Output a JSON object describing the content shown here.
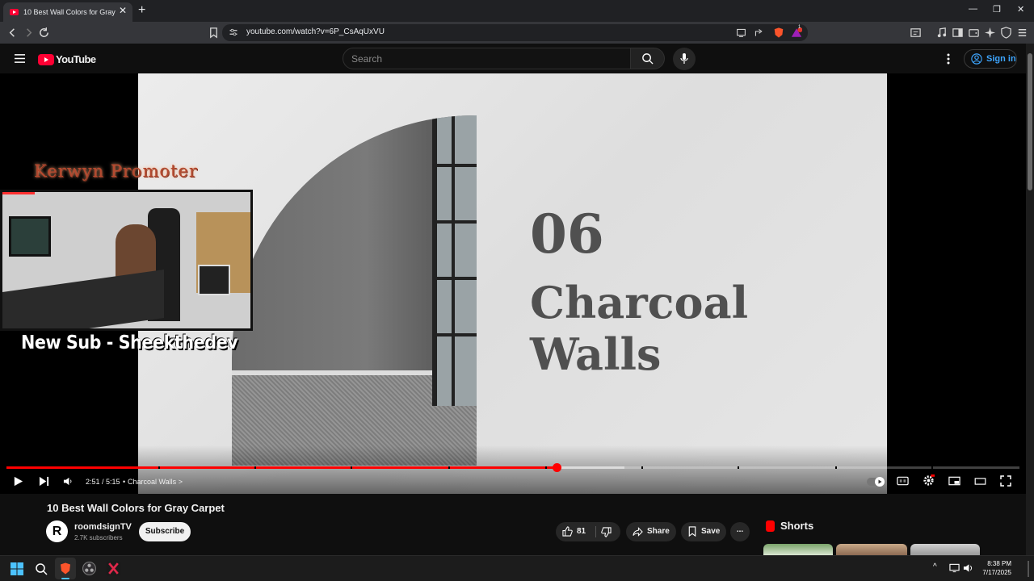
{
  "browser": {
    "tab_title": "10 Best Wall Colors for Gray Carpet",
    "url": "youtube.com/watch?v=6P_CsAqUxVU",
    "badge_count": "1"
  },
  "youtube": {
    "logo_text": "YouTube",
    "search_placeholder": "Search",
    "sign_in_label": "Sign in"
  },
  "video_frame": {
    "number": "06",
    "heading_line1": "Charcoal",
    "heading_line2": "Walls"
  },
  "overlay": {
    "promoter_title": "Kerwyn Promoter",
    "new_sub_text": "New Sub - Sheekthedev"
  },
  "player": {
    "time_display": "2:51 / 5:15",
    "separator": "•",
    "chapter_label": "Charcoal Walls",
    "chapter_arrow": ">",
    "progress_fraction": 0.543,
    "buffered_fraction": 0.61,
    "chapter_marks": [
      0.15,
      0.245,
      0.34,
      0.436,
      0.532,
      0.627,
      0.722,
      0.818,
      0.913
    ]
  },
  "video": {
    "title": "10 Best Wall Colors for Gray Carpet",
    "channel_initial": "R",
    "channel_name": "roomdsignTV",
    "subscribers": "2.7K subscribers",
    "subscribe_label": "Subscribe",
    "like_count": "81",
    "share_label": "Share",
    "save_label": "Save",
    "more_label": "..."
  },
  "sidebar": {
    "shorts_title": "Shorts"
  },
  "taskbar": {
    "time": "8:38 PM",
    "date": "7/17/2025"
  },
  "colors": {
    "youtube_red": "#ff0033",
    "progress_red": "#ff0000",
    "link_blue": "#3ea6ff"
  }
}
